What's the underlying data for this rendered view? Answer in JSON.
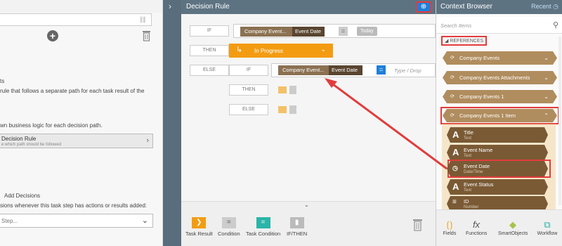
{
  "left": {
    "text_1": "ts",
    "text_2": "rule that follows a separate path for each task result of the",
    "text_3": "wn business logic for each decision path.",
    "rule_title": "Decision Rule",
    "rule_sub": "e which path should be followed",
    "text_4": "Add Decisions",
    "text_5": "sions whenever this task step has actions or results added:",
    "step_placeholder": "Step..."
  },
  "center": {
    "title": "Decision Rule",
    "if_label": "IF",
    "then_label": "THEN",
    "else_label": "ELSE",
    "chip1_a": "Company Event...",
    "chip1_b": "Event Date",
    "today": "Today",
    "progress": "In Progress",
    "chip2_a": "Company Event...",
    "chip2_b": "Event Date",
    "drop_placeholder": "Type / Drop",
    "tools": [
      {
        "label": "Task Result"
      },
      {
        "label": "Condition"
      },
      {
        "label": "Task Condition"
      },
      {
        "label": "IF/THEN"
      }
    ]
  },
  "right": {
    "title": "Context Browser",
    "recent": "Recent",
    "search_placeholder": "Search Items",
    "references": "REFERENCES",
    "groups": [
      "Company Events",
      "Company Events Attachments",
      "Company Events 1",
      "Company Events 1 Item"
    ],
    "items": [
      {
        "name": "Title",
        "type": "Text"
      },
      {
        "name": "Event Name",
        "type": "Text"
      },
      {
        "name": "Event Date",
        "type": "Date/Time"
      },
      {
        "name": "Event Status",
        "type": "Text"
      },
      {
        "name": "ID",
        "type": "Number"
      }
    ],
    "bottom": [
      "Fields",
      "Functions",
      "SmartObjects",
      "Workflow"
    ]
  },
  "colors": {
    "header": "#5e7382",
    "accent": "#1e7fd8",
    "orange": "#f39c12",
    "chip": "#8b7152",
    "highlight": "#e23c3c"
  }
}
